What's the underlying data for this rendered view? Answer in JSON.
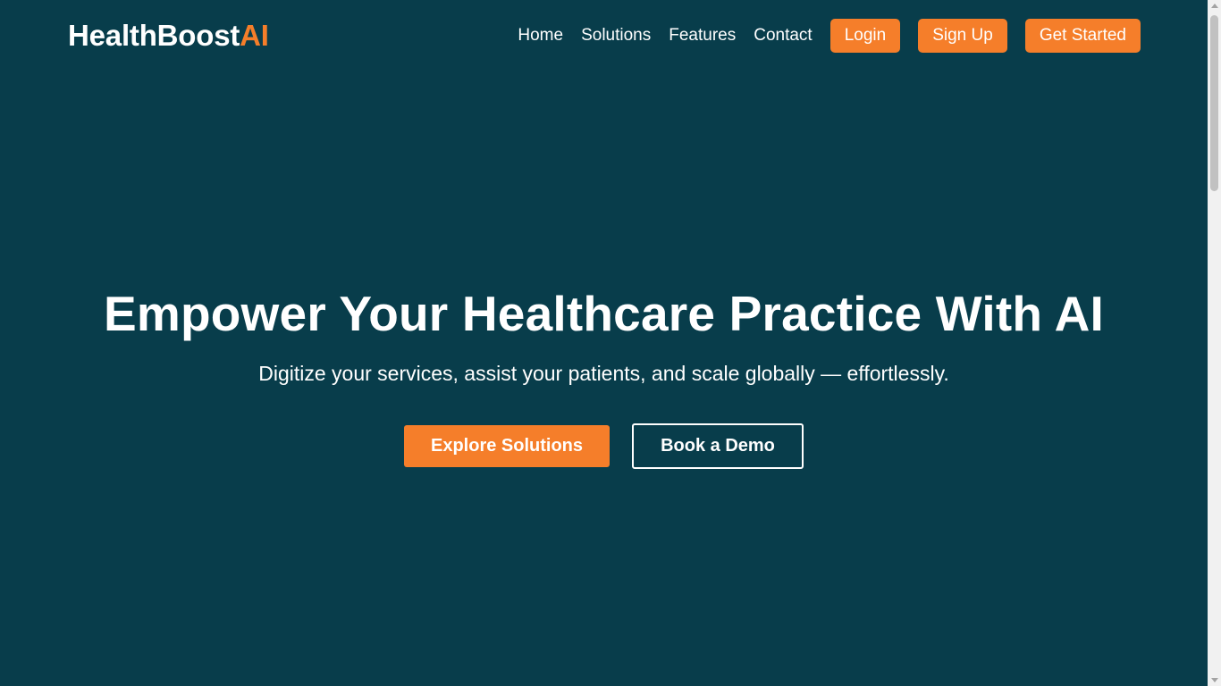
{
  "header": {
    "logo_main": "HealthBoost",
    "logo_accent": "AI",
    "nav": {
      "home": "Home",
      "solutions": "Solutions",
      "features": "Features",
      "contact": "Contact"
    },
    "buttons": {
      "login": "Login",
      "signup": "Sign Up",
      "get_started": "Get Started"
    }
  },
  "hero": {
    "title": "Empower Your Healthcare Practice With AI",
    "subtitle": "Digitize your services, assist your patients, and scale globally — effortlessly.",
    "primary_cta": "Explore Solutions",
    "secondary_cta": "Book a Demo"
  },
  "colors": {
    "background": "#083d4b",
    "accent": "#f57e2a",
    "text": "#ffffff"
  }
}
